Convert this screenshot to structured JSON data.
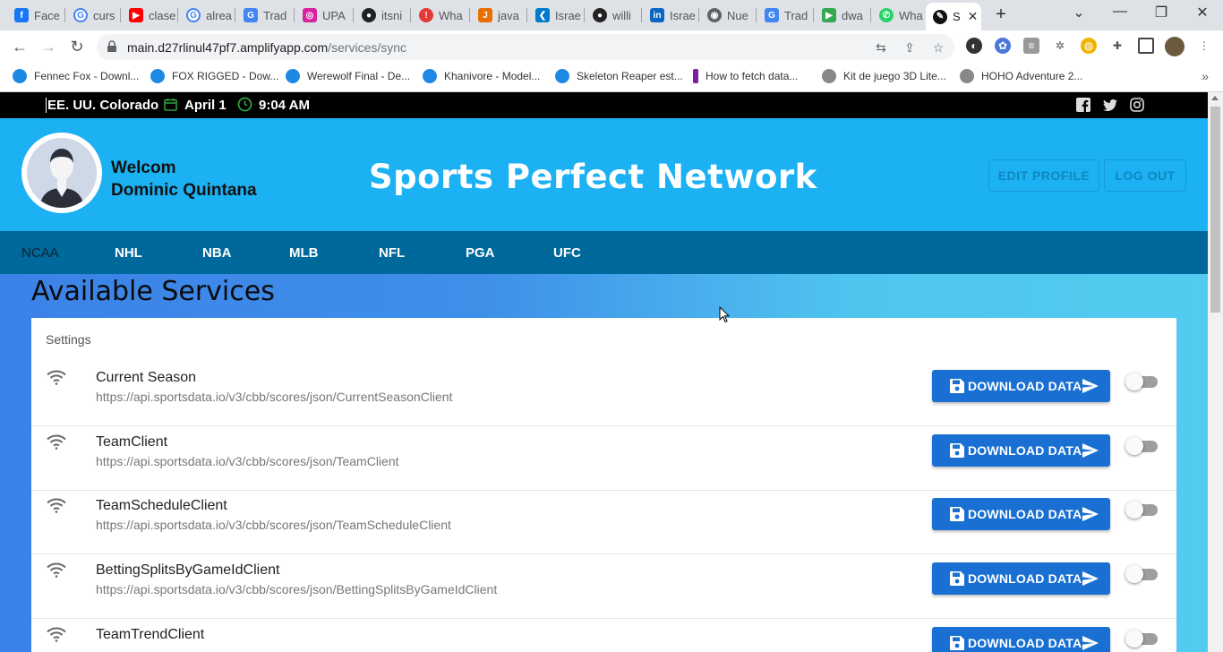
{
  "browser": {
    "tabs": [
      {
        "label": "Face",
        "icon": "facebook-icon",
        "color": "#1877f2"
      },
      {
        "label": "curs",
        "icon": "google-icon",
        "color": "#4285f4"
      },
      {
        "label": "clase",
        "icon": "youtube-icon",
        "color": "#ff0000"
      },
      {
        "label": "alrea",
        "icon": "google-icon",
        "color": "#4285f4"
      },
      {
        "label": "Trad",
        "icon": "translate-icon",
        "color": "#4285f4"
      },
      {
        "label": "UPA",
        "icon": "instagram-icon",
        "color": "#d6249f"
      },
      {
        "label": "itsni",
        "icon": "github-icon",
        "color": "#222222"
      },
      {
        "label": "Wha",
        "icon": "alert-icon",
        "color": "#e53935"
      },
      {
        "label": "java",
        "icon": "java-icon",
        "color": "#e76f00"
      },
      {
        "label": "Israe",
        "icon": "vscode-icon",
        "color": "#007acc"
      },
      {
        "label": "willi",
        "icon": "github-icon",
        "color": "#222222"
      },
      {
        "label": "Israe",
        "icon": "linkedin-icon",
        "color": "#0a66c2"
      },
      {
        "label": "Nue",
        "icon": "chrome-icon",
        "color": "#5f6368"
      },
      {
        "label": "Trad",
        "icon": "translate-icon",
        "color": "#4285f4"
      },
      {
        "label": "dwa",
        "icon": "play-icon",
        "color": "#34a853"
      },
      {
        "label": "Wha",
        "icon": "whatsapp-icon",
        "color": "#25d366"
      },
      {
        "label": "S",
        "icon": "sports-icon",
        "color": "#111111"
      }
    ],
    "address": {
      "domain": "main.d27rlinul47pf7.amplifyapp.com",
      "path": "/services/sync"
    },
    "bookmarks": [
      "Fennec Fox - Downl...",
      "FOX RIGGED - Dow...",
      "Werewolf Final - De...",
      "Khanivore - Model...",
      "Skeleton Reaper est...",
      "How to fetch data...",
      "Kit de juego 3D Lite...",
      "HOHO Adventure 2..."
    ]
  },
  "topbar": {
    "location": "EE. UU. Colorado",
    "date": "April 1",
    "time": "9:04 AM"
  },
  "header": {
    "welcome": "Welcom",
    "user_name": "Dominic Quintana",
    "brand": "Sports Perfect Network",
    "edit_profile": "EDIT PROFILE",
    "log_out": "LOG OUT"
  },
  "nav": [
    "NCAA",
    "NHL",
    "NBA",
    "MLB",
    "NFL",
    "PGA",
    "UFC"
  ],
  "main": {
    "title": "Available Services",
    "card_heading": "Settings",
    "download_label": "DOWNLOAD DATA",
    "services": [
      {
        "name": "Current Season",
        "url": "https://api.sportsdata.io/v3/cbb/scores/json/CurrentSeasonClient",
        "enabled": false
      },
      {
        "name": "TeamClient",
        "url": "https://api.sportsdata.io/v3/cbb/scores/json/TeamClient",
        "enabled": false
      },
      {
        "name": "TeamScheduleClient",
        "url": "https://api.sportsdata.io/v3/cbb/scores/json/TeamScheduleClient",
        "enabled": false
      },
      {
        "name": "BettingSplitsByGameIdClient",
        "url": "https://api.sportsdata.io/v3/cbb/scores/json/BettingSplitsByGameIdClient",
        "enabled": false
      },
      {
        "name": "TeamTrendClient",
        "url": "",
        "enabled": false
      }
    ]
  },
  "colors": {
    "header_bg": "#1cb1f2",
    "nav_bg": "#00699b",
    "button_bg": "#1970d2",
    "topbar_bg": "#000000"
  }
}
